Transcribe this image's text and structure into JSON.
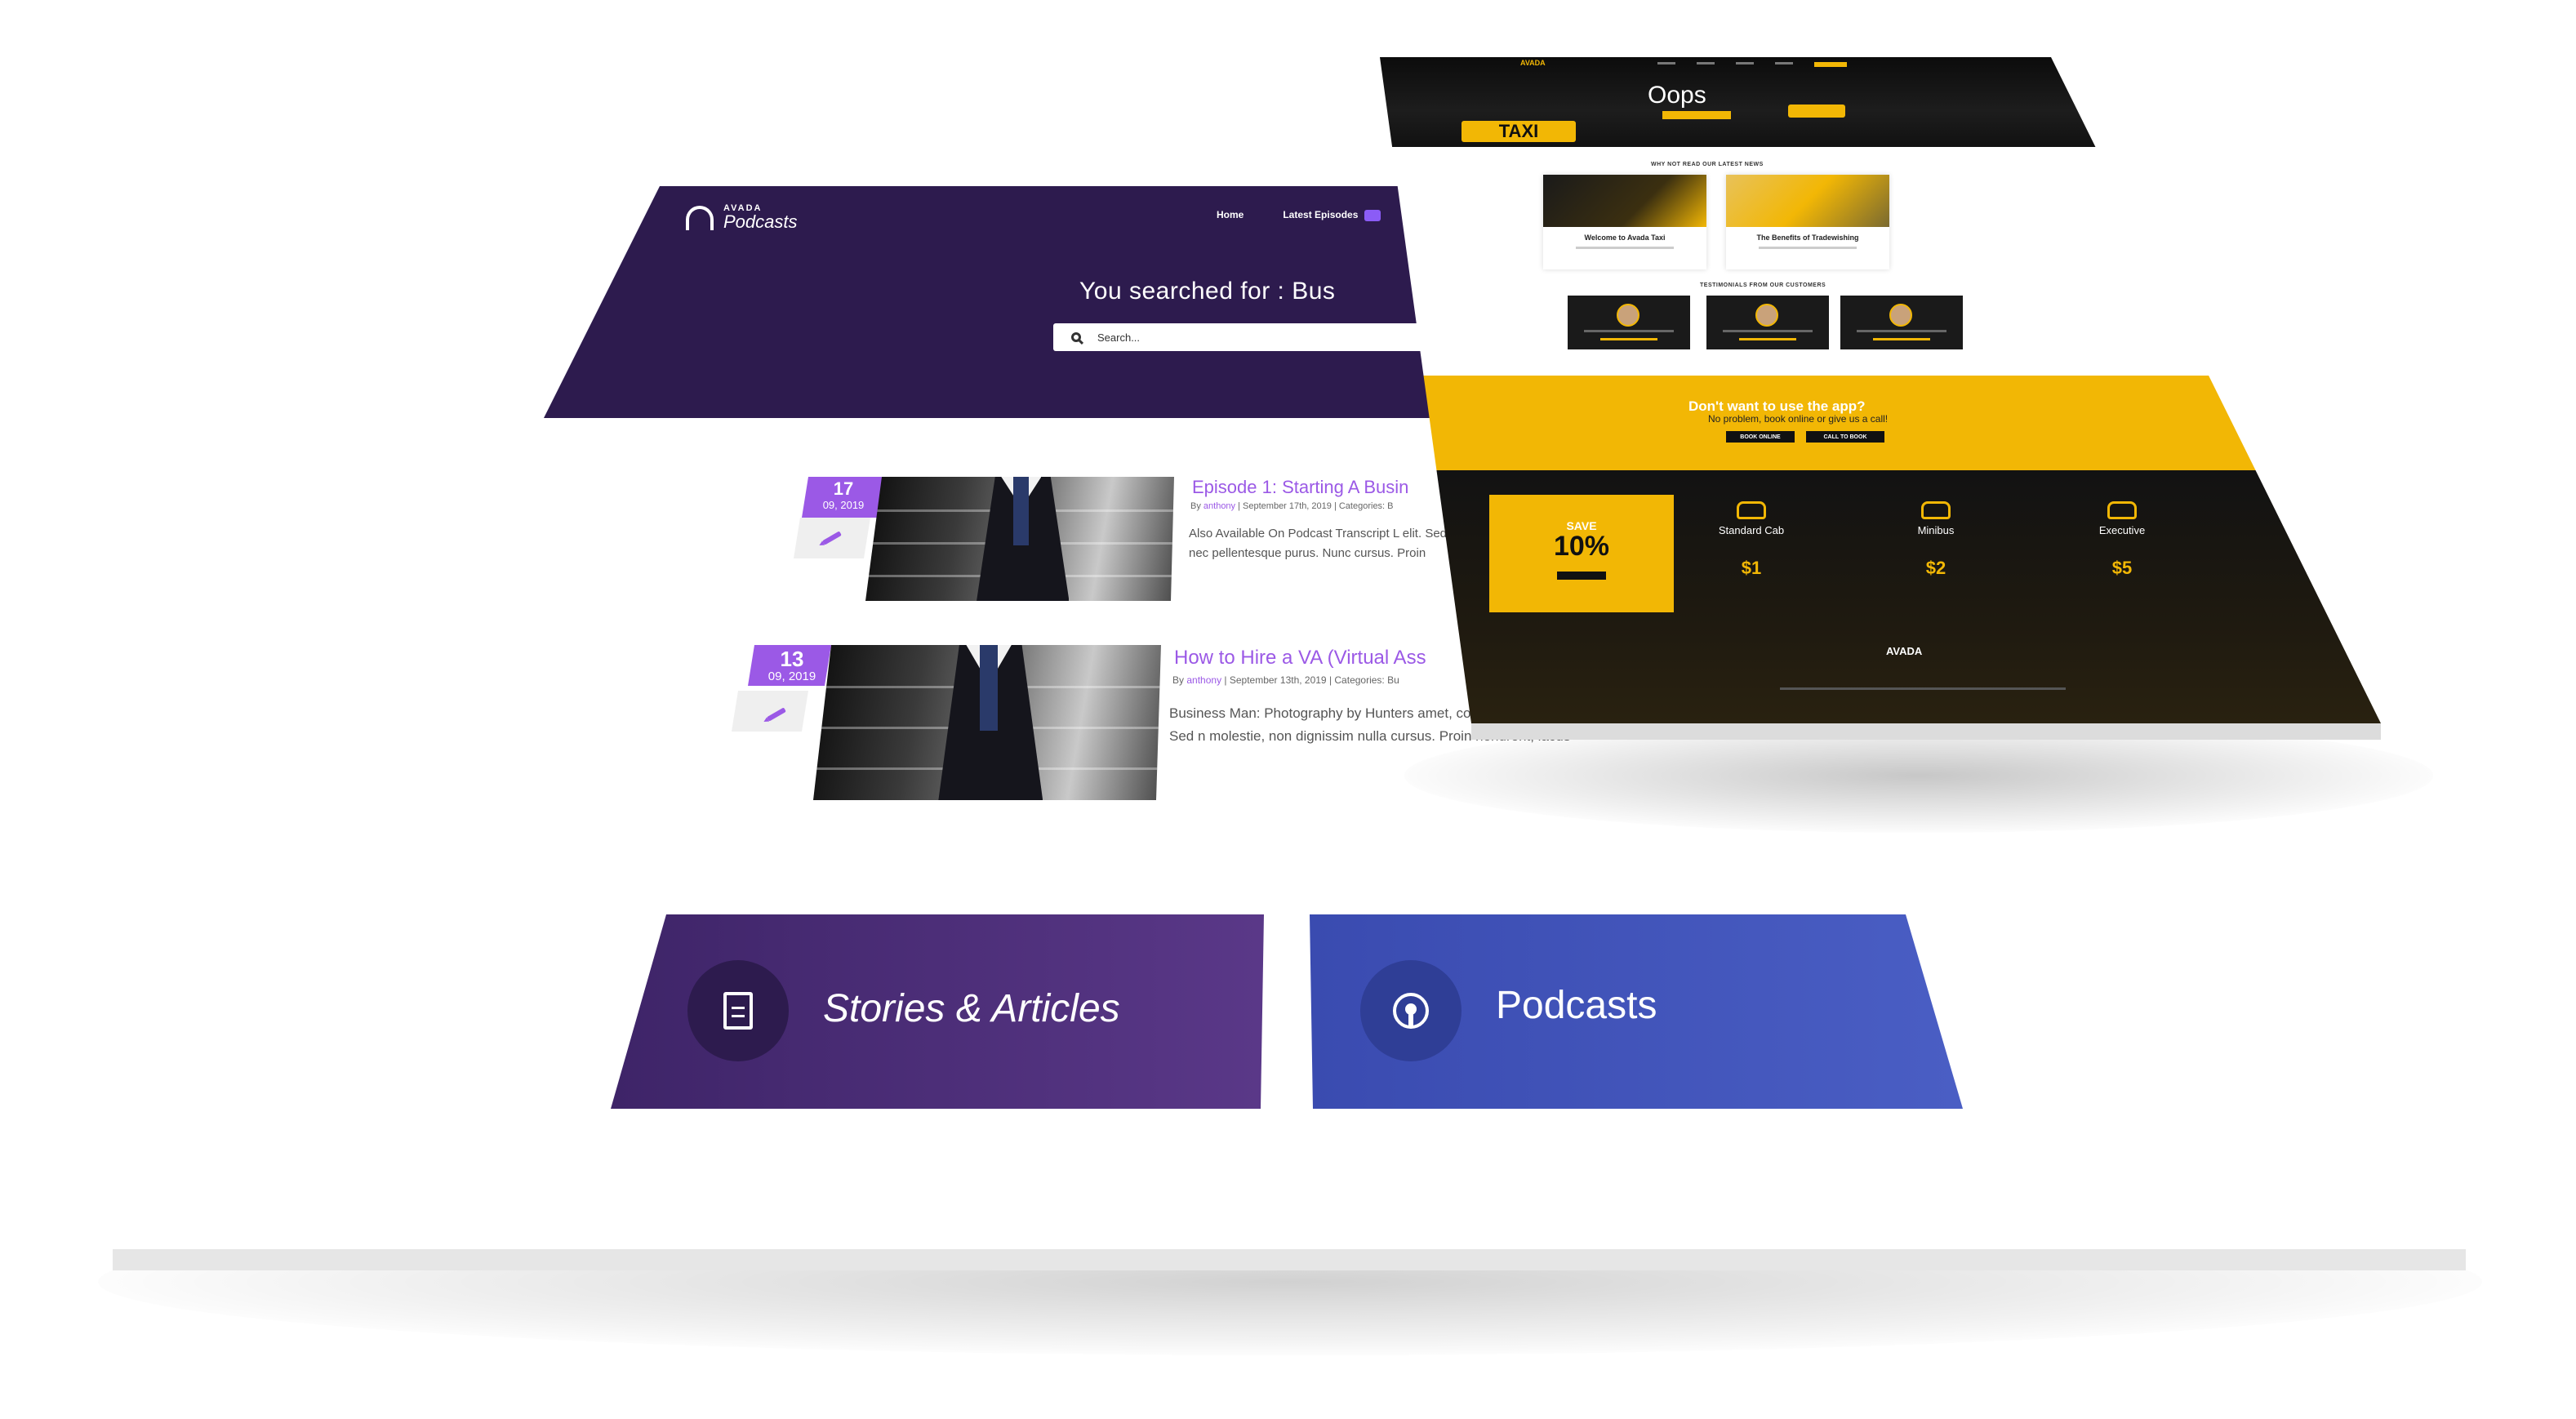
{
  "podcast_page": {
    "logo": {
      "small": "AVADA",
      "big": "Podcasts"
    },
    "nav": [
      "Home",
      "Latest Episodes"
    ],
    "search": {
      "title": "You searched for : Bus",
      "placeholder": "Search..."
    },
    "posts": [
      {
        "day": "17",
        "month_year": "09, 2019",
        "title": "Episode 1: Starting A Busin",
        "meta_by": "By",
        "author": "anthony",
        "meta_rest": "| September 17th, 2019 | Categories: B",
        "excerpt": "Also Available On Podcast Transcript L elit. Sed nec pellentesque purus. Nunc cursus. Proin"
      },
      {
        "day": "13",
        "month_year": "09, 2019",
        "title": "How to Hire a VA (Virtual Ass",
        "meta_by": "By",
        "author": "anthony",
        "meta_rest": "| September 13th, 2019 | Categories: Bu",
        "excerpt": "Business Man: Photography by Hunters amet, consectetur adipiscing elit. Sed n molestie, non dignissim nulla cursus. Proin hendrerit, lacus"
      }
    ],
    "categories": [
      {
        "label": "Stories & Articles",
        "icon": "document-icon",
        "color": "#4b2a7a"
      },
      {
        "label": "Podcasts",
        "icon": "podcast-icon",
        "color": "#3d4fb8"
      }
    ],
    "colors": {
      "header": "#2d1b4e",
      "accent": "#9b59e6"
    }
  },
  "taxi_page": {
    "logo": "AVADA",
    "hero_title": "Oops",
    "taxi_sign": "TAXI",
    "news_section_title": "WHY NOT READ OUR LATEST NEWS",
    "news": [
      {
        "title": "Welcome to Avada Taxi"
      },
      {
        "title": "The Benefits of Tradewishing"
      }
    ],
    "testimonials_title": "TESTIMONIALS FROM OUR CUSTOMERS",
    "cta": {
      "title": "Don't want to use the app?",
      "subtitle": "No problem, book online or give us a call!",
      "buttons": [
        "BOOK ONLINE",
        "CALL TO BOOK"
      ]
    },
    "promo": {
      "save": "SAVE",
      "percent": "10%"
    },
    "cars": [
      {
        "name": "Standard Cab",
        "price": "$1"
      },
      {
        "name": "Minibus",
        "price": "$2"
      },
      {
        "name": "Executive",
        "price": "$5"
      }
    ],
    "footer_logo": "AVADA",
    "colors": {
      "accent": "#f2b705",
      "dark": "#121212"
    }
  }
}
